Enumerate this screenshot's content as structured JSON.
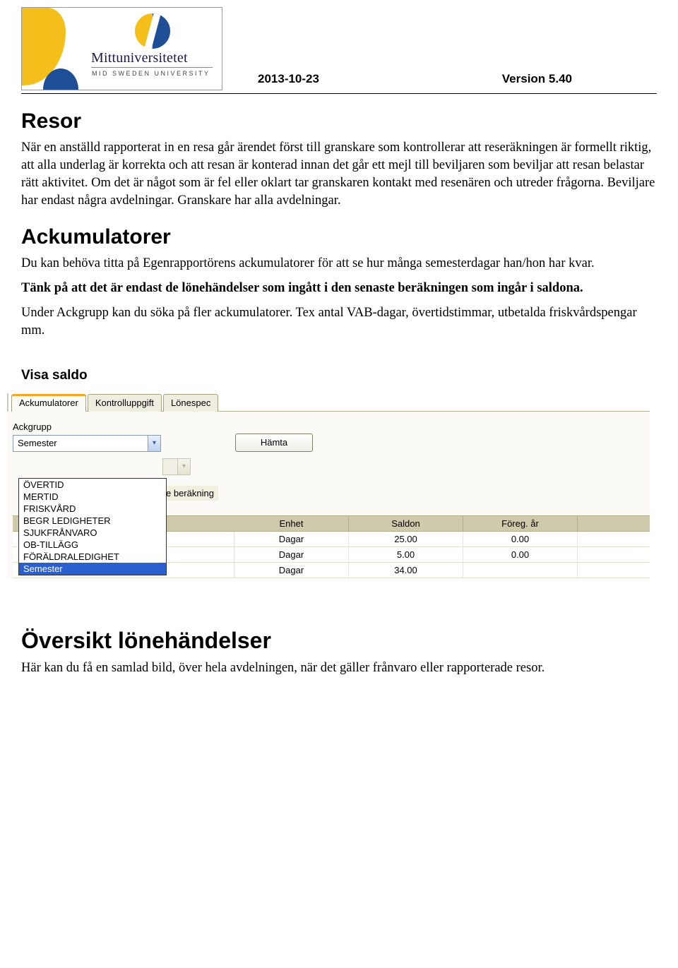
{
  "header": {
    "logo_name": "Mittuniversitetet",
    "logo_sub": "MID SWEDEN UNIVERSITY",
    "date": "2013-10-23",
    "version": "Version 5.40"
  },
  "sections": {
    "resor_title": "Resor",
    "resor_body": "När en anställd rapporterat in en resa går ärendet först till granskare som kontrollerar att reseräkningen är formellt riktig, att alla underlag är korrekta och att resan är konterad innan det går ett mejl till beviljaren som beviljar att resan belastar rätt aktivitet. Om det är något som är fel eller oklart tar granskaren kontakt med resenären och utreder frågorna. Beviljare har endast några avdelningar. Granskare har alla avdelningar.",
    "ack_title": "Ackumulatorer",
    "ack_p1": "Du kan behöva titta på Egenrapportörens ackumulatorer för att se hur många semesterdagar han/hon har kvar.",
    "ack_p2": "Tänk på att det är endast de lönehändelser som ingått i den senaste beräkningen som ingår i saldona.",
    "ack_p3": "Under Ackgrupp kan du söka på fler ackumulatorer. Tex antal VAB-dagar, övertidstimmar, utbetalda friskvårdspengar mm.",
    "visa_saldo": "Visa saldo",
    "oversikt_title": "Översikt lönehändelser",
    "oversikt_body": "Här kan du få en samlad bild, över hela avdelningen, när det gäller frånvaro eller rapporterade resor."
  },
  "ui": {
    "tabs": {
      "t0": "Ackumulatorer",
      "t1": "Kontrolluppgift",
      "t2": "Lönespec"
    },
    "ackgrupp_label": "Ackgrupp",
    "selected_value": "Semester",
    "hamta_label": "Hämta",
    "peeking": "e beräkning",
    "options": {
      "o0": "ÖVERTID",
      "o1": "MERTID",
      "o2": "FRISKVÅRD",
      "o3": "BEGR LEDIGHETER",
      "o4": "SJUKFRÅNVARO",
      "o5": "OB-TILLÄGG",
      "o6": "FÖRÄLDRALEDIGHET",
      "o7": "Semester"
    },
    "headers": {
      "h0": "Enhet",
      "h1": "Saldon",
      "h2": "Föreg. år"
    },
    "rows": {
      "r0": {
        "c0": "Dagar",
        "c1": "25.00",
        "c2": "0.00"
      },
      "r1": {
        "c0": "Dagar",
        "c1": "5.00",
        "c2": "0.00"
      },
      "r2": {
        "c0": "Dagar",
        "c1": "34.00",
        "c2": ""
      }
    }
  }
}
